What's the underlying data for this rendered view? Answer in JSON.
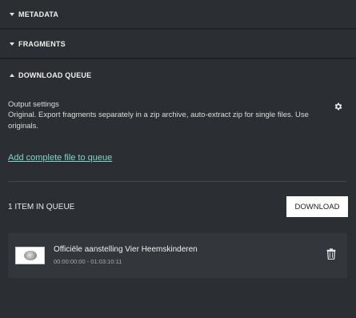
{
  "sections": {
    "metadata": {
      "label": "METADATA",
      "state": "collapsed"
    },
    "fragments": {
      "label": "FRAGMENTS",
      "state": "collapsed"
    },
    "download_queue": {
      "label": "DOWNLOAD QUEUE",
      "state": "expanded"
    }
  },
  "output": {
    "label": "Output settings",
    "description": "Original. Export fragments separately in a zip archive, auto-extract zip for single files. Use originals.",
    "settings_icon": "gear-icon"
  },
  "add_link": "Add complete file to queue",
  "queue": {
    "count_label": "1 ITEM IN QUEUE",
    "download_label": "DOWNLOAD",
    "items": [
      {
        "title": "Officiële aanstelling Vier Heemskinderen",
        "time_range": "00:00:00:00 - 01:03:10:11",
        "delete_icon": "trash-icon"
      }
    ]
  },
  "colors": {
    "background": "#2b2e32",
    "divider": "#202326",
    "link": "#7fd6c4",
    "item_background": "#33373b"
  }
}
